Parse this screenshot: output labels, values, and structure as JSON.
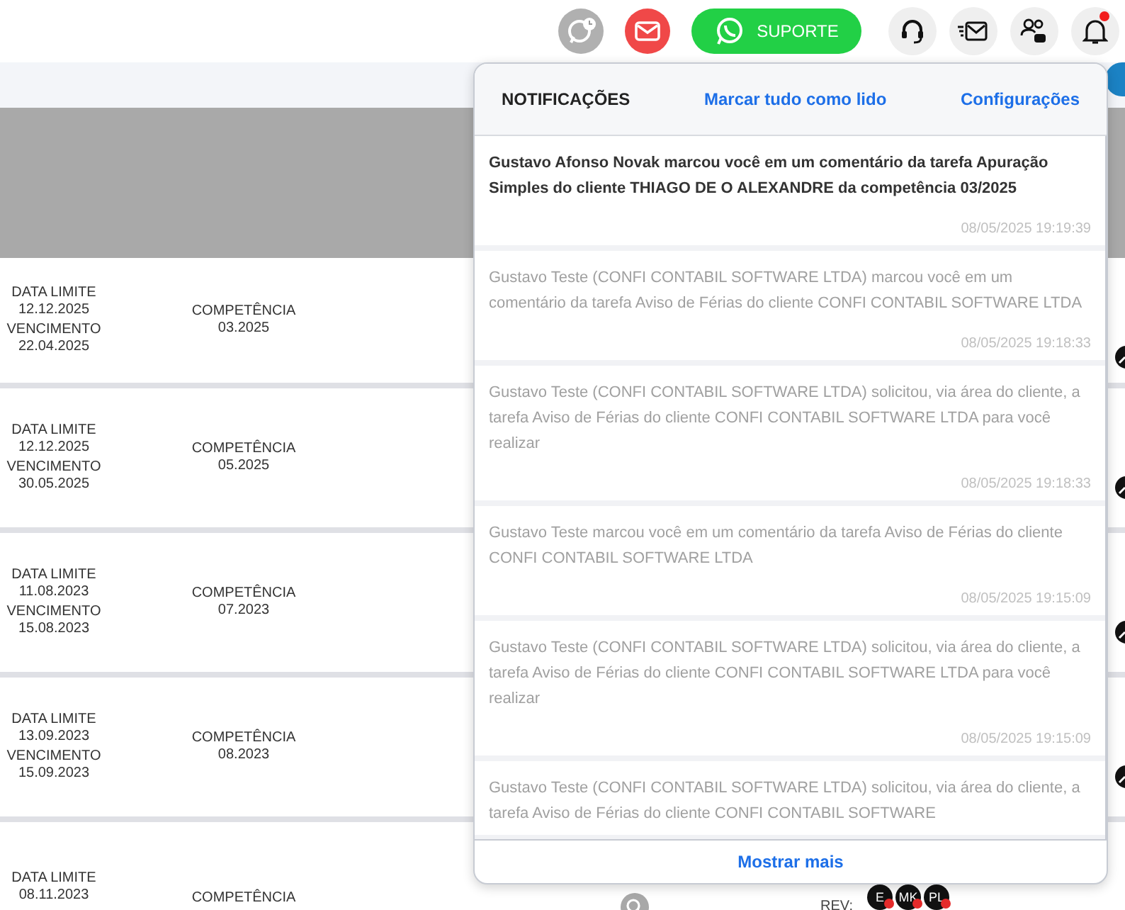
{
  "toolbar": {
    "support_button": "SUPORTE",
    "bell_unread": true
  },
  "rows": [
    {
      "deadline_label": "DATA LIMITE",
      "deadline": "12.12.2025",
      "due_label": "VENCIMENTO",
      "due": "22.04.2025",
      "period_label": "COMPETÊNCIA",
      "period": "03.2025"
    },
    {
      "deadline_label": "DATA LIMITE",
      "deadline": "12.12.2025",
      "due_label": "VENCIMENTO",
      "due": "30.05.2025",
      "period_label": "COMPETÊNCIA",
      "period": "05.2025"
    },
    {
      "deadline_label": "DATA LIMITE",
      "deadline": "11.08.2023",
      "due_label": "VENCIMENTO",
      "due": "15.08.2023",
      "period_label": "COMPETÊNCIA",
      "period": "07.2023"
    },
    {
      "deadline_label": "DATA LIMITE",
      "deadline": "13.09.2023",
      "due_label": "VENCIMENTO",
      "due": "15.09.2023",
      "period_label": "COMPETÊNCIA",
      "period": "08.2023"
    },
    {
      "deadline_label": "DATA LIMITE",
      "deadline": "08.11.2023",
      "period_label": "COMPETÊNCIA",
      "reviewers_label": "REV:",
      "reviewers": [
        {
          "initials": "E"
        },
        {
          "initials": "MK"
        },
        {
          "initials": "PL"
        }
      ]
    }
  ],
  "notifications": {
    "title": "NOTIFICAÇÕES",
    "mark_all": "Marcar tudo como lido",
    "settings": "Configurações",
    "items": [
      {
        "text": "Gustavo Afonso Novak marcou você em um comentário da tarefa Apuração Simples do cliente THIAGO DE O ALEXANDRE da competência 03/2025",
        "time": "08/05/2025 19:19:39",
        "unread": true
      },
      {
        "text": "Gustavo Teste (CONFI CONTABIL SOFTWARE LTDA) marcou você em um comentário da tarefa Aviso de Férias do cliente CONFI CONTABIL SOFTWARE LTDA",
        "time": "08/05/2025 19:18:33",
        "unread": false
      },
      {
        "text": "Gustavo Teste (CONFI CONTABIL SOFTWARE LTDA) solicitou, via área do cliente, a tarefa Aviso de Férias do cliente CONFI CONTABIL SOFTWARE LTDA para você realizar",
        "time": "08/05/2025 19:18:33",
        "unread": false
      },
      {
        "text": "Gustavo Teste marcou você em um comentário da tarefa Aviso de Férias do cliente CONFI CONTABIL SOFTWARE LTDA",
        "time": "08/05/2025 19:15:09",
        "unread": false
      },
      {
        "text": "Gustavo Teste (CONFI CONTABIL SOFTWARE LTDA) solicitou, via área do cliente, a tarefa Aviso de Férias do cliente CONFI CONTABIL SOFTWARE LTDA para você realizar",
        "time": "08/05/2025 19:15:09",
        "unread": false
      },
      {
        "text": "Gustavo Teste (CONFI CONTABIL SOFTWARE LTDA) solicitou, via área do cliente, a tarefa Aviso de Férias do cliente CONFI CONTABIL SOFTWARE",
        "unread": false
      }
    ],
    "show_more": "Mostrar mais"
  }
}
